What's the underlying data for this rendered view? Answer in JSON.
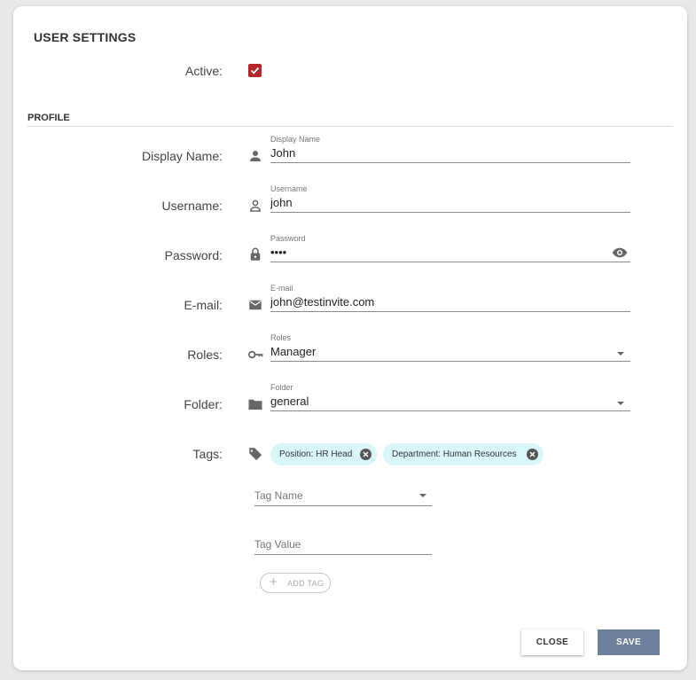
{
  "dialog": {
    "title": "USER SETTINGS"
  },
  "active": {
    "label": "Active:",
    "checked": true
  },
  "profile_section": {
    "heading": "PROFILE"
  },
  "fields": {
    "display_name": {
      "label": "Display Name:",
      "float_label": "Display Name",
      "value": "John",
      "icon": "person-icon"
    },
    "username": {
      "label": "Username:",
      "float_label": "Username",
      "value": "john",
      "icon": "person-outline-icon"
    },
    "password": {
      "label": "Password:",
      "float_label": "Password",
      "value": "••••",
      "icon": "lock-icon"
    },
    "email": {
      "label": "E-mail:",
      "float_label": "E-mail",
      "value": "john@testinvite.com",
      "icon": "mail-icon"
    },
    "roles": {
      "label": "Roles:",
      "float_label": "Roles",
      "value": "Manager",
      "icon": "key-icon"
    },
    "folder": {
      "label": "Folder:",
      "float_label": "Folder",
      "value": "general",
      "icon": "folder-icon"
    }
  },
  "tags": {
    "label": "Tags:",
    "icon": "tag-icon",
    "chips": [
      {
        "text": "Position: HR Head"
      },
      {
        "text": "Department: Human Resources"
      }
    ],
    "tag_name_placeholder": "Tag Name",
    "tag_value_placeholder": "Tag Value",
    "add_tag_label": "ADD TAG"
  },
  "actions": {
    "close_label": "CLOSE",
    "save_label": "SAVE"
  },
  "colors": {
    "checkbox": "#b3262b",
    "chip_bg": "#d9f6fa",
    "save_button": "#6d809b"
  }
}
